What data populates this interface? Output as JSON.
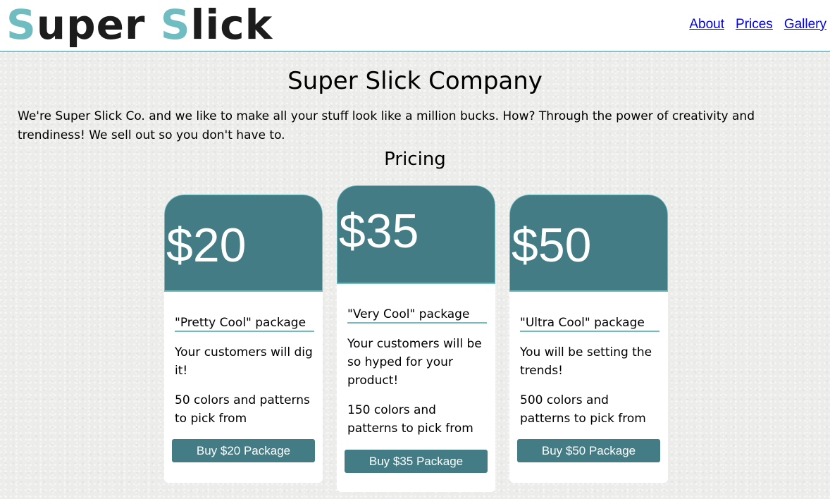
{
  "header": {
    "logo_part1_accent": "S",
    "logo_part1_rest": "uper ",
    "logo_part2_accent": "S",
    "logo_part2_rest": "lick",
    "nav": [
      {
        "label": "About"
      },
      {
        "label": "Prices"
      },
      {
        "label": "Gallery"
      }
    ]
  },
  "main": {
    "title": "Super Slick Company",
    "intro": "We're Super Slick Co. and we like to make all your stuff look like a million bucks. How? Through the power of creativity and trendiness! We sell out so you don't have to.",
    "pricing_heading": "Pricing"
  },
  "cards": [
    {
      "price": "$20",
      "name": "\"Pretty Cool\" package",
      "text": "Your customers will dig it!",
      "features": "50 colors and patterns to pick from",
      "button": "Buy $20 Package"
    },
    {
      "price": "$35",
      "name": "\"Very Cool\" package",
      "text": "Your customers will be so hyped for your product!",
      "features": "150 colors and patterns to pick from",
      "button": "Buy $35 Package"
    },
    {
      "price": "$50",
      "name": "\"Ultra Cool\" package",
      "text": "You will be setting the trends!",
      "features": "500 colors and patterns to pick from",
      "button": "Buy $50 Package"
    }
  ],
  "colors": {
    "accent": "#6fbdc1",
    "card_header": "#437c84",
    "link": "#0000ee"
  }
}
